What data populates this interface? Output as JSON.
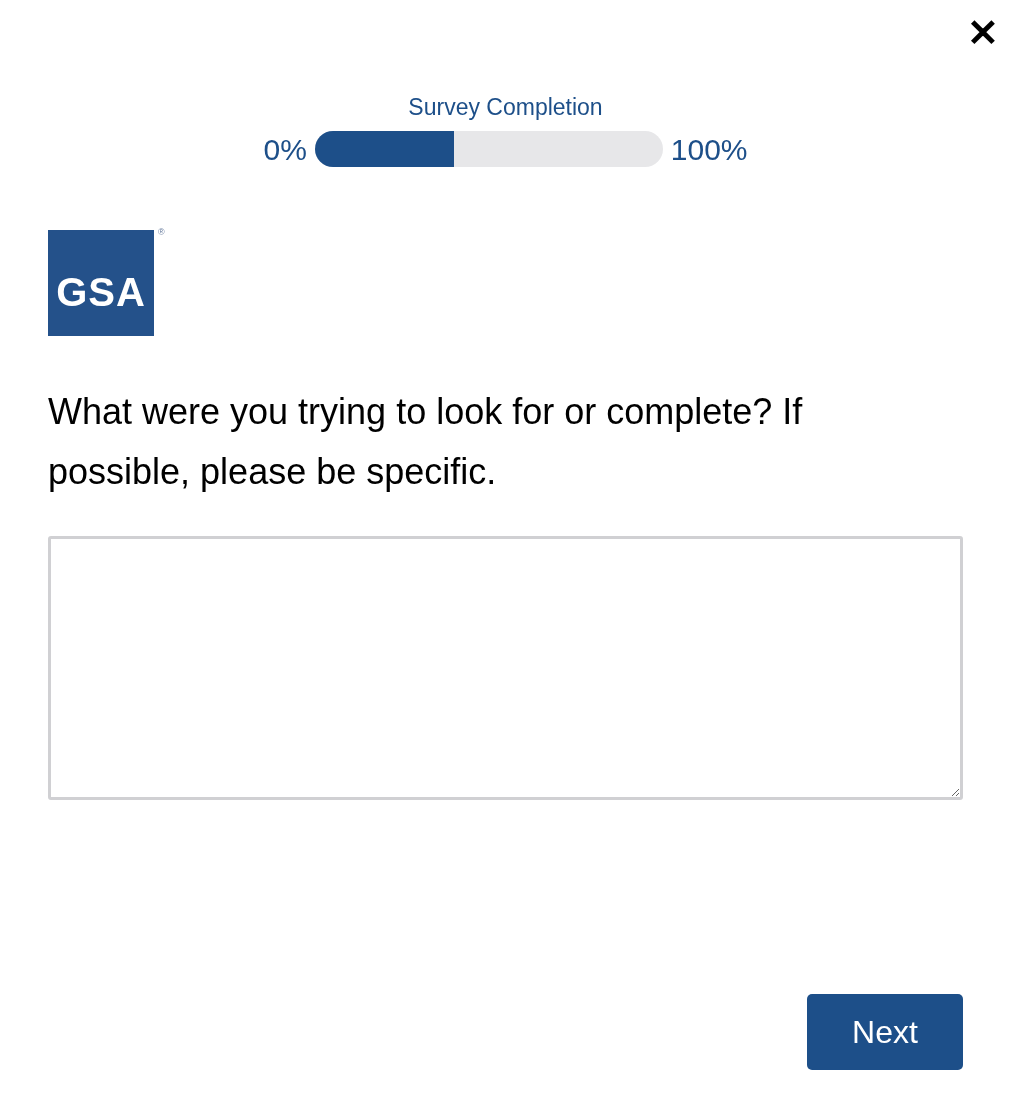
{
  "close": {
    "label": "✕"
  },
  "progress": {
    "title": "Survey Completion",
    "min_label": "0%",
    "max_label": "100%",
    "level": 0.4
  },
  "logo": {
    "text": "GSA",
    "mark": "®"
  },
  "question": {
    "text": "What were you trying to look for or complete? If possible, please be specific."
  },
  "buttons": [
    "Next"
  ]
}
